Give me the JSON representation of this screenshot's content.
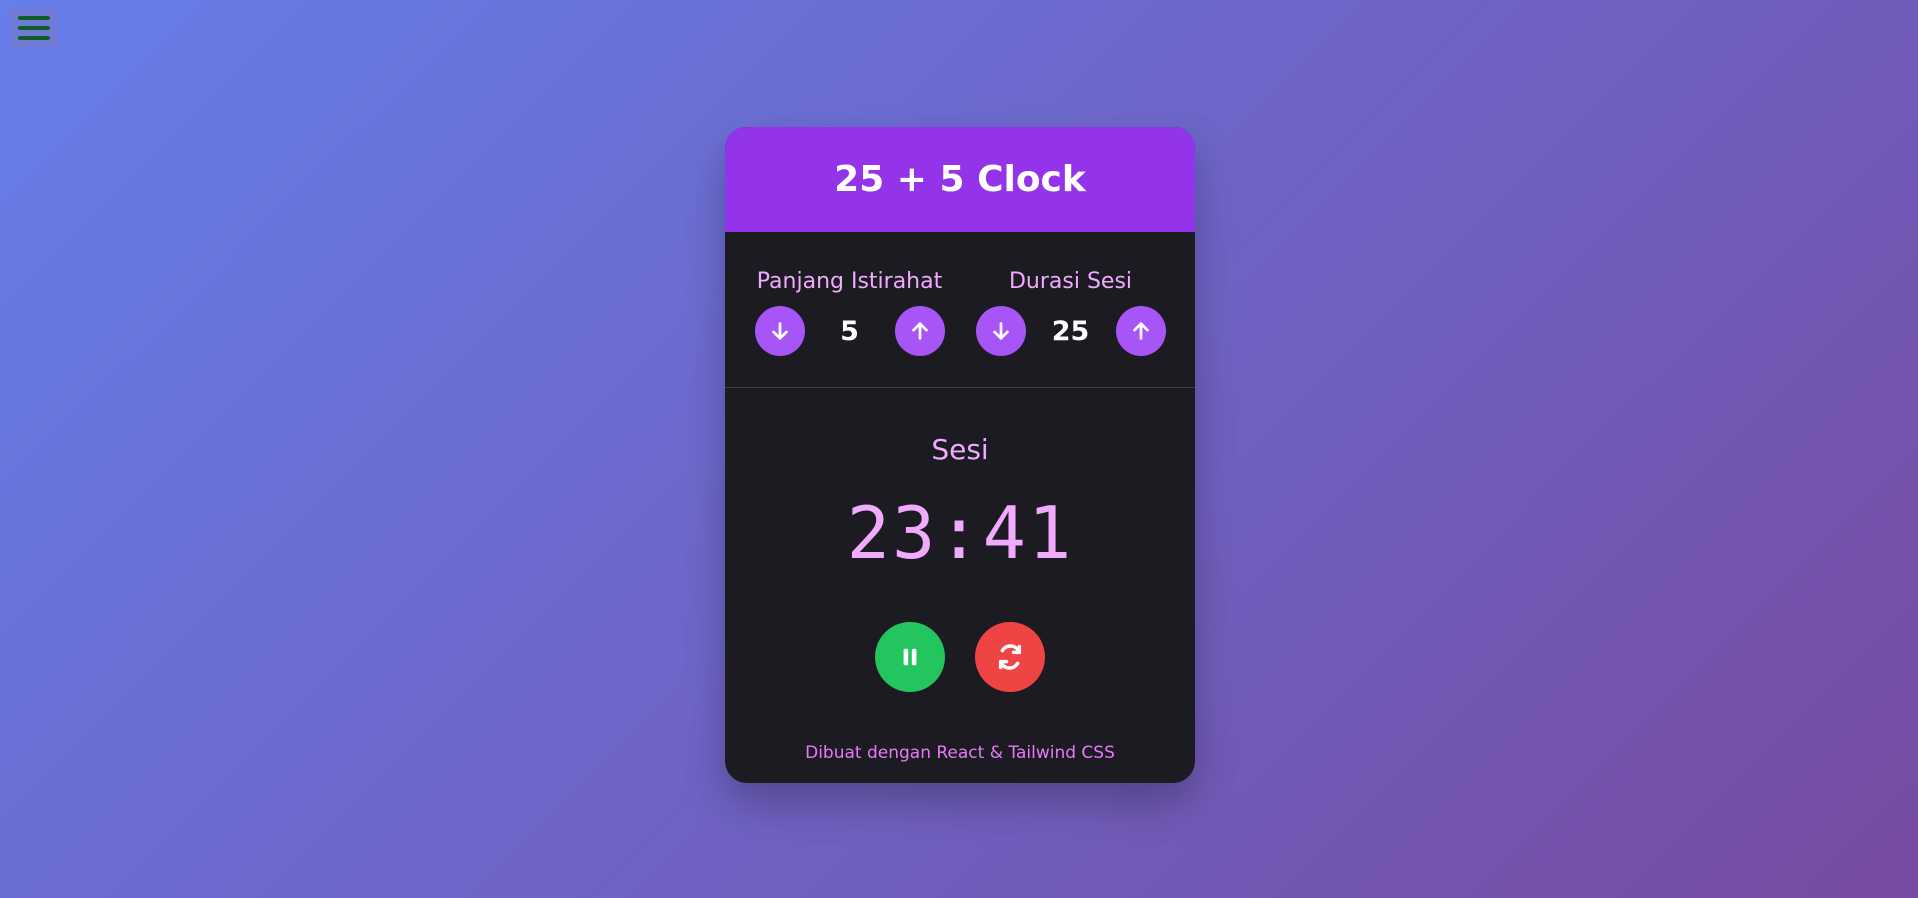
{
  "header": {
    "title": "25 + 5 Clock"
  },
  "break": {
    "label": "Panjang Istirahat",
    "value": "5"
  },
  "session": {
    "label": "Durasi Sesi",
    "value": "25"
  },
  "timer": {
    "label": "Sesi",
    "time": "23:41"
  },
  "footer": {
    "text": "Dibuat dengan React & Tailwind CSS"
  },
  "icons": {
    "menu": "hamburger-menu-icon",
    "decrement": "arrow-down-icon",
    "increment": "arrow-up-icon",
    "play_pause": "pause-icon",
    "reset": "refresh-icon"
  },
  "colors": {
    "accent": "#9333ea",
    "control": "#a855f7",
    "card": "#1c1b22",
    "text_accent": "#f0abfc",
    "pause": "#22c55e",
    "reset": "#ef4444"
  }
}
